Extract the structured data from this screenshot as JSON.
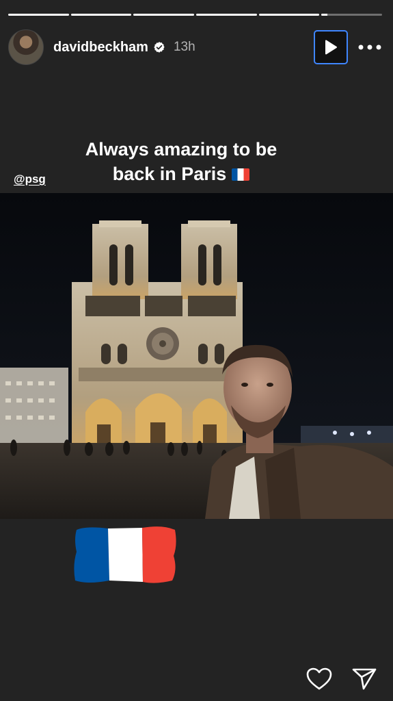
{
  "story": {
    "progress": [
      1,
      1,
      1,
      1,
      1,
      0.1
    ],
    "username": "davidbeckham",
    "time_ago": "13h",
    "caption_line1": "Always amazing to be",
    "caption_line2": "back in Paris",
    "mention": "@psg"
  },
  "icons": {
    "verified": "verified-badge-icon",
    "play": "play-icon",
    "more": "more-dots-icon",
    "like": "heart-icon",
    "share": "send-icon"
  },
  "colors": {
    "background": "#232323",
    "play_border": "#3f86ff",
    "flag_blue": "#0055a4",
    "flag_white": "#ffffff",
    "flag_red": "#ef4135"
  }
}
